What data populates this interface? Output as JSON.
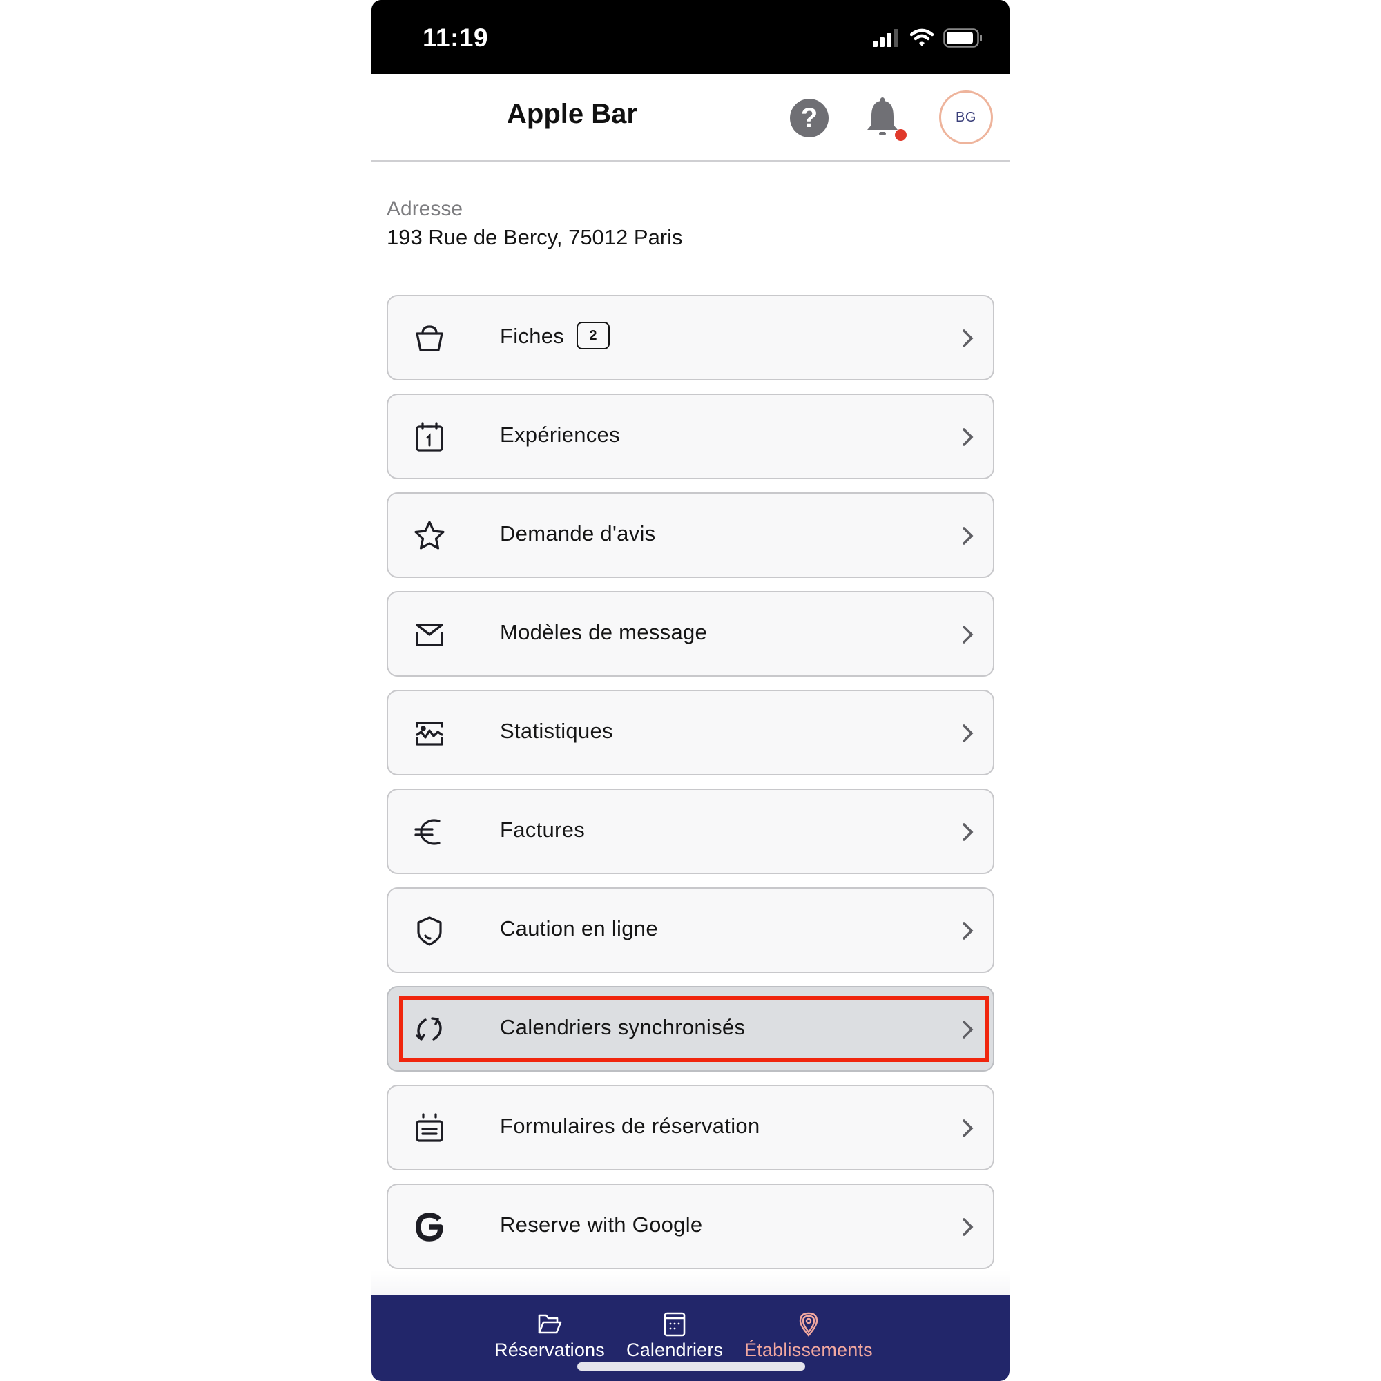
{
  "status_bar": {
    "time": "11:19",
    "icons": [
      "cellular-signal-icon",
      "wifi-icon",
      "battery-icon"
    ]
  },
  "header": {
    "title": "Apple Bar",
    "help_icon": "question-circle-icon",
    "help_glyph": "?",
    "notification_icon": "bell-icon",
    "notification_dot": true,
    "avatar_initials": "BG"
  },
  "address": {
    "label": "Adresse",
    "value": "193 Rue de Bercy, 75012 Paris"
  },
  "menu": {
    "items": [
      {
        "label": "Fiches",
        "icon": "basket-icon",
        "badge": "2"
      },
      {
        "label": "Expériences",
        "icon": "calendar-day-icon"
      },
      {
        "label": "Demande d'avis",
        "icon": "star-icon"
      },
      {
        "label": "Modèles de message",
        "icon": "envelope-icon"
      },
      {
        "label": "Statistiques",
        "icon": "statistics-icon"
      },
      {
        "label": "Factures",
        "icon": "euro-icon"
      },
      {
        "label": "Caution en ligne",
        "icon": "shield-icon"
      },
      {
        "label": "Calendriers synchronisés",
        "icon": "sync-icon",
        "highlighted": true
      },
      {
        "label": "Formulaires de réservation",
        "icon": "form-calendar-icon"
      },
      {
        "label": "Reserve with Google",
        "icon": "google-icon"
      }
    ],
    "chevron_icon": "chevron-right-icon"
  },
  "bottom_nav": {
    "items": [
      {
        "label": "Réservations",
        "icon": "folder-open-icon",
        "active": false
      },
      {
        "label": "Calendriers",
        "icon": "calendar-grid-icon",
        "active": false
      },
      {
        "label": "Établissements",
        "icon": "location-pin-icon",
        "active": true
      }
    ]
  },
  "colors": {
    "nav_background": "#22266a",
    "nav_active": "#f2a8a0",
    "highlight_border": "#f0250d",
    "avatar_ring": "#eeb49c",
    "notification_dot": "#e0392b"
  }
}
